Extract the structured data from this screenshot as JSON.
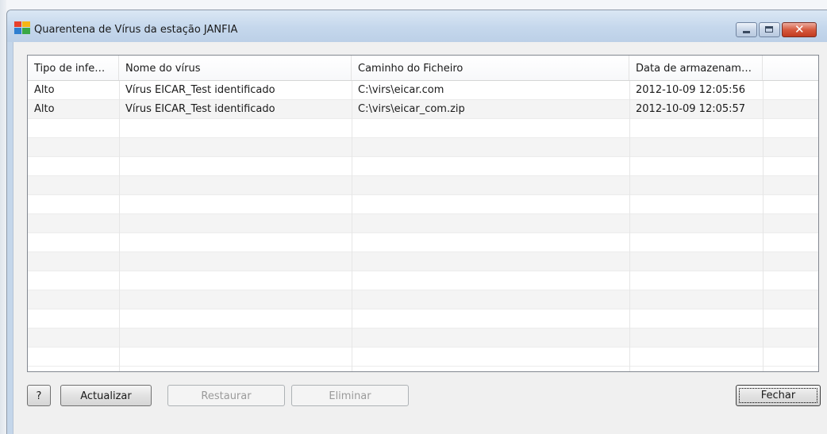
{
  "window": {
    "title": "Quarentena de Vírus da estação JANFIA",
    "icon": "avg-logo-icon"
  },
  "colors": {
    "titlebar": "#c5d7ec",
    "close_button": "#d65a3f",
    "alt_row": "#f4f4f4",
    "disabled_text": "#9a9a9a"
  },
  "table": {
    "columns": [
      "Tipo de infe…",
      "Nome do vírus",
      "Caminho do Ficheiro",
      "Data de armazenam…",
      ""
    ],
    "rows": [
      [
        "Alto",
        "Vírus EICAR_Test identificado",
        "C:\\virs\\eicar.com",
        "2012-10-09 12:05:56",
        ""
      ],
      [
        "Alto",
        "Vírus EICAR_Test identificado",
        "C:\\virs\\eicar_com.zip",
        "2012-10-09 12:05:57",
        ""
      ]
    ]
  },
  "buttons": {
    "help": "?",
    "refresh": "Actualizar",
    "restore": "Restaurar",
    "delete": "Eliminar",
    "close": "Fechar"
  }
}
